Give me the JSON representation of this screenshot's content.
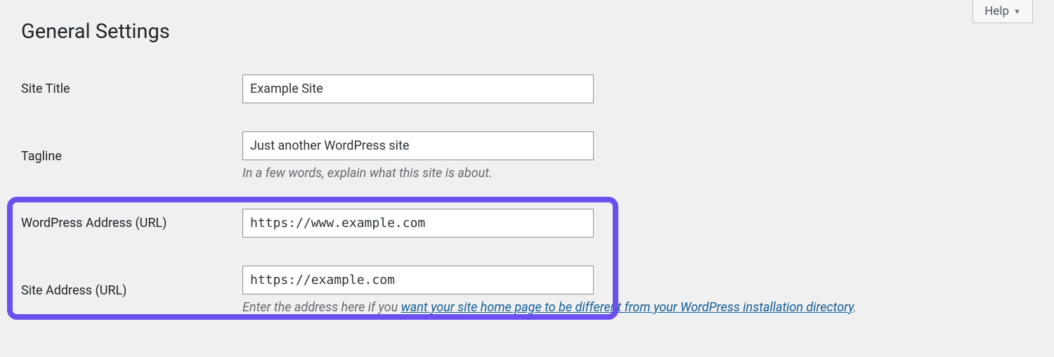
{
  "help": {
    "label": "Help"
  },
  "page": {
    "title": "General Settings"
  },
  "fields": {
    "site_title": {
      "label": "Site Title",
      "value": "Example Site"
    },
    "tagline": {
      "label": "Tagline",
      "value": "Just another WordPress site",
      "description": "In a few words, explain what this site is about."
    },
    "wp_url": {
      "label": "WordPress Address (URL)",
      "value": "https://www.example.com"
    },
    "site_url": {
      "label": "Site Address (URL)",
      "value": "https://example.com",
      "desc_before": "Enter the address here if you ",
      "desc_link": "want your site home page to be different from your WordPress installation directory",
      "desc_after": "."
    }
  }
}
